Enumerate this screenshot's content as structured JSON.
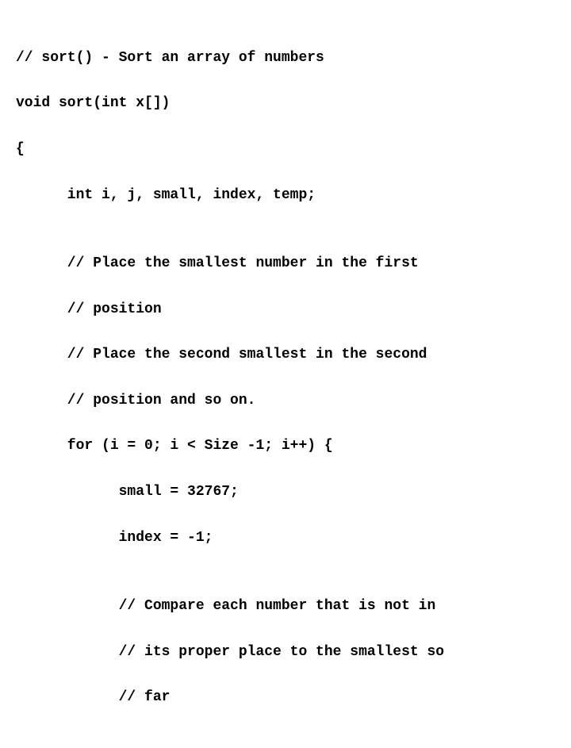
{
  "code": {
    "lines": [
      "// sort() - Sort an array of numbers",
      "void sort(int x[])",
      "{",
      "      int i, j, small, index, temp;",
      "",
      "      // Place the smallest number in the first",
      "      // position",
      "      // Place the second smallest in the second",
      "      // position and so on.",
      "      for (i = 0; i < Size -1; i++) {",
      "            small = 32767;",
      "            index = -1;",
      "",
      "            // Compare each number that is not in",
      "            // its proper place to the smallest so",
      "            // far"
    ]
  }
}
